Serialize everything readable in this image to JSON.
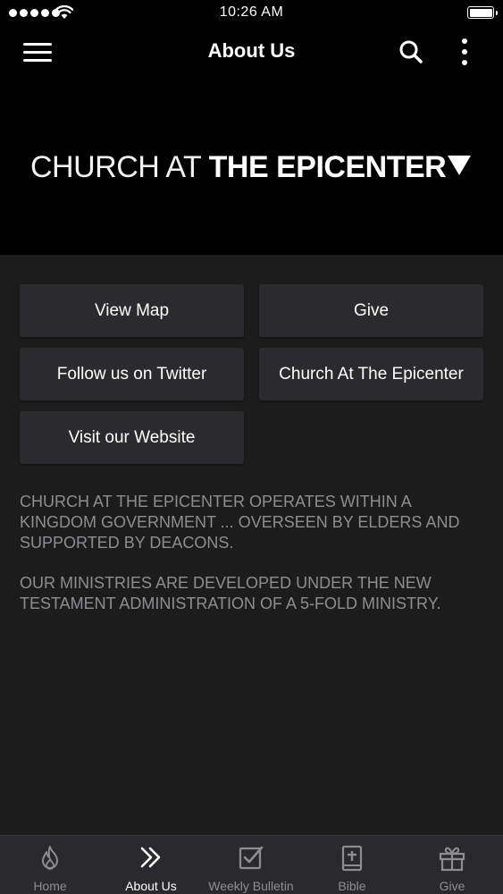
{
  "status_bar": {
    "time": "10:26 AM"
  },
  "nav": {
    "title": "About Us"
  },
  "banner": {
    "logo_thin": "CHURCH AT ",
    "logo_bold": "THE EPICENTER"
  },
  "buttons": [
    {
      "label": "View Map"
    },
    {
      "label": "Give"
    },
    {
      "label": "Follow us on Twitter"
    },
    {
      "label": "Church At The Epicenter"
    },
    {
      "label": "Visit our Website"
    }
  ],
  "description": {
    "paragraph1": "CHURCH AT THE EPICENTER OPERATES WITHIN A KINGDOM GOVERNMENT ... OVERSEEN BY ELDERS AND SUPPORTED BY DEACONS.",
    "paragraph2": "OUR MINISTRIES ARE DEVELOPED UNDER THE NEW TESTAMENT ADMINISTRATION OF A 5-FOLD MINISTRY."
  },
  "tabs": [
    {
      "label": "Home",
      "icon": "flame-icon",
      "active": false
    },
    {
      "label": "About Us",
      "icon": "double-chevron-right-icon",
      "active": true
    },
    {
      "label": "Weekly Bulletin",
      "icon": "checkbox-icon",
      "active": false
    },
    {
      "label": "Bible",
      "icon": "book-plus-icon",
      "active": false
    },
    {
      "label": "Give",
      "icon": "gift-icon",
      "active": false
    }
  ],
  "colors": {
    "background": "#1c1c1d",
    "header": "#000000",
    "button": "#2b2b2d",
    "muted_text": "#8e8e92",
    "tab_bar": "#2a2a2c"
  }
}
